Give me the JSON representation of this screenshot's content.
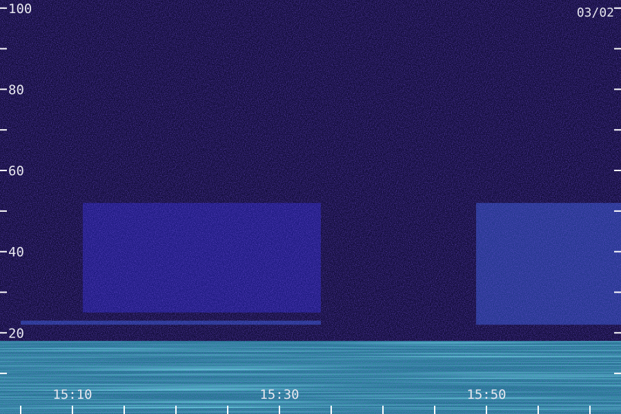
{
  "chart_data": {
    "type": "heatmap",
    "title": "",
    "xlabel": "",
    "ylabel": "",
    "date": "03/02",
    "x_axis": {
      "range": [
        "15:03",
        "16:03"
      ],
      "major_ticks": [
        "15:10",
        "15:30",
        "15:50"
      ],
      "minor_tick_interval_minutes": 5
    },
    "y_axis": {
      "range": [
        0,
        102
      ],
      "labeled_ticks": [
        20,
        40,
        60,
        80,
        100
      ],
      "minor_tick_interval": 10
    },
    "colormap": [
      "#120c3a",
      "#1e1488",
      "#2c2dd6",
      "#3a6cf4",
      "#2fd8d2",
      "#9af070"
    ],
    "features": [
      {
        "name": "low band",
        "y_range": [
          0,
          18
        ],
        "x_range": [
          "15:03",
          "16:03"
        ],
        "intensity": 0.85
      },
      {
        "name": "band",
        "y_range": [
          25,
          52
        ],
        "x_range": [
          "15:11",
          "15:34"
        ],
        "intensity": 0.4
      },
      {
        "name": "band",
        "y_range": [
          22,
          52
        ],
        "x_range": [
          "15:49",
          "16:03"
        ],
        "intensity": 0.55
      },
      {
        "name": "horizontal line",
        "y_range": [
          22,
          23
        ],
        "x_range": [
          "15:05",
          "15:34"
        ],
        "intensity": 0.6
      }
    ]
  }
}
